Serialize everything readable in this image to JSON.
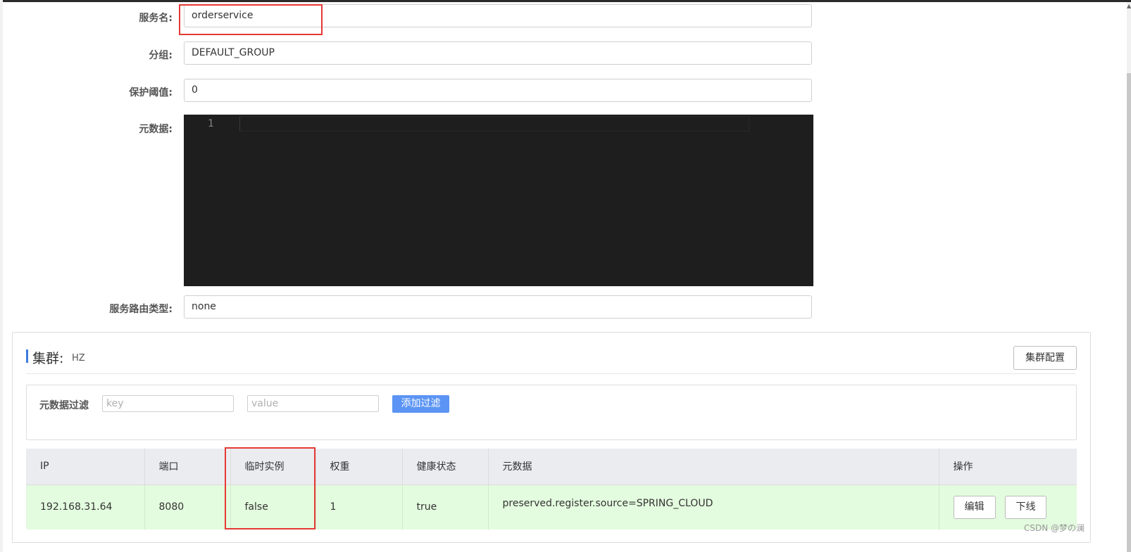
{
  "form": {
    "service_name_label": "服务名:",
    "service_name_value": "orderservice",
    "group_label": "分组:",
    "group_value": "DEFAULT_GROUP",
    "threshold_label": "保护阈值:",
    "threshold_value": "0",
    "metadata_label": "元数据:",
    "metadata_line_number": "1",
    "route_type_label": "服务路由类型:",
    "route_type_value": "none"
  },
  "cluster": {
    "title": "集群:",
    "name": "HZ",
    "config_button": "集群配置",
    "filter": {
      "label": "元数据过滤",
      "key_placeholder": "key",
      "value_placeholder": "value",
      "add_button": "添加过滤"
    },
    "table": {
      "headers": [
        "IP",
        "端口",
        "临时实例",
        "权重",
        "健康状态",
        "元数据",
        "操作"
      ],
      "rows": [
        {
          "ip": "192.168.31.64",
          "port": "8080",
          "ephemeral": "false",
          "weight": "1",
          "healthy": "true",
          "metadata": "preserved.register.source=SPRING_CLOUD",
          "edit_button": "编辑",
          "offline_button": "下线"
        }
      ]
    }
  },
  "watermark": "CSDN @梦の澜",
  "colors": {
    "highlight_box": "#e53935",
    "primary_button": "#5b94f4",
    "row_healthy_bg": "#e3fbde",
    "editor_bg": "#1e1e1e",
    "accent_bar": "#3d7bdc"
  }
}
